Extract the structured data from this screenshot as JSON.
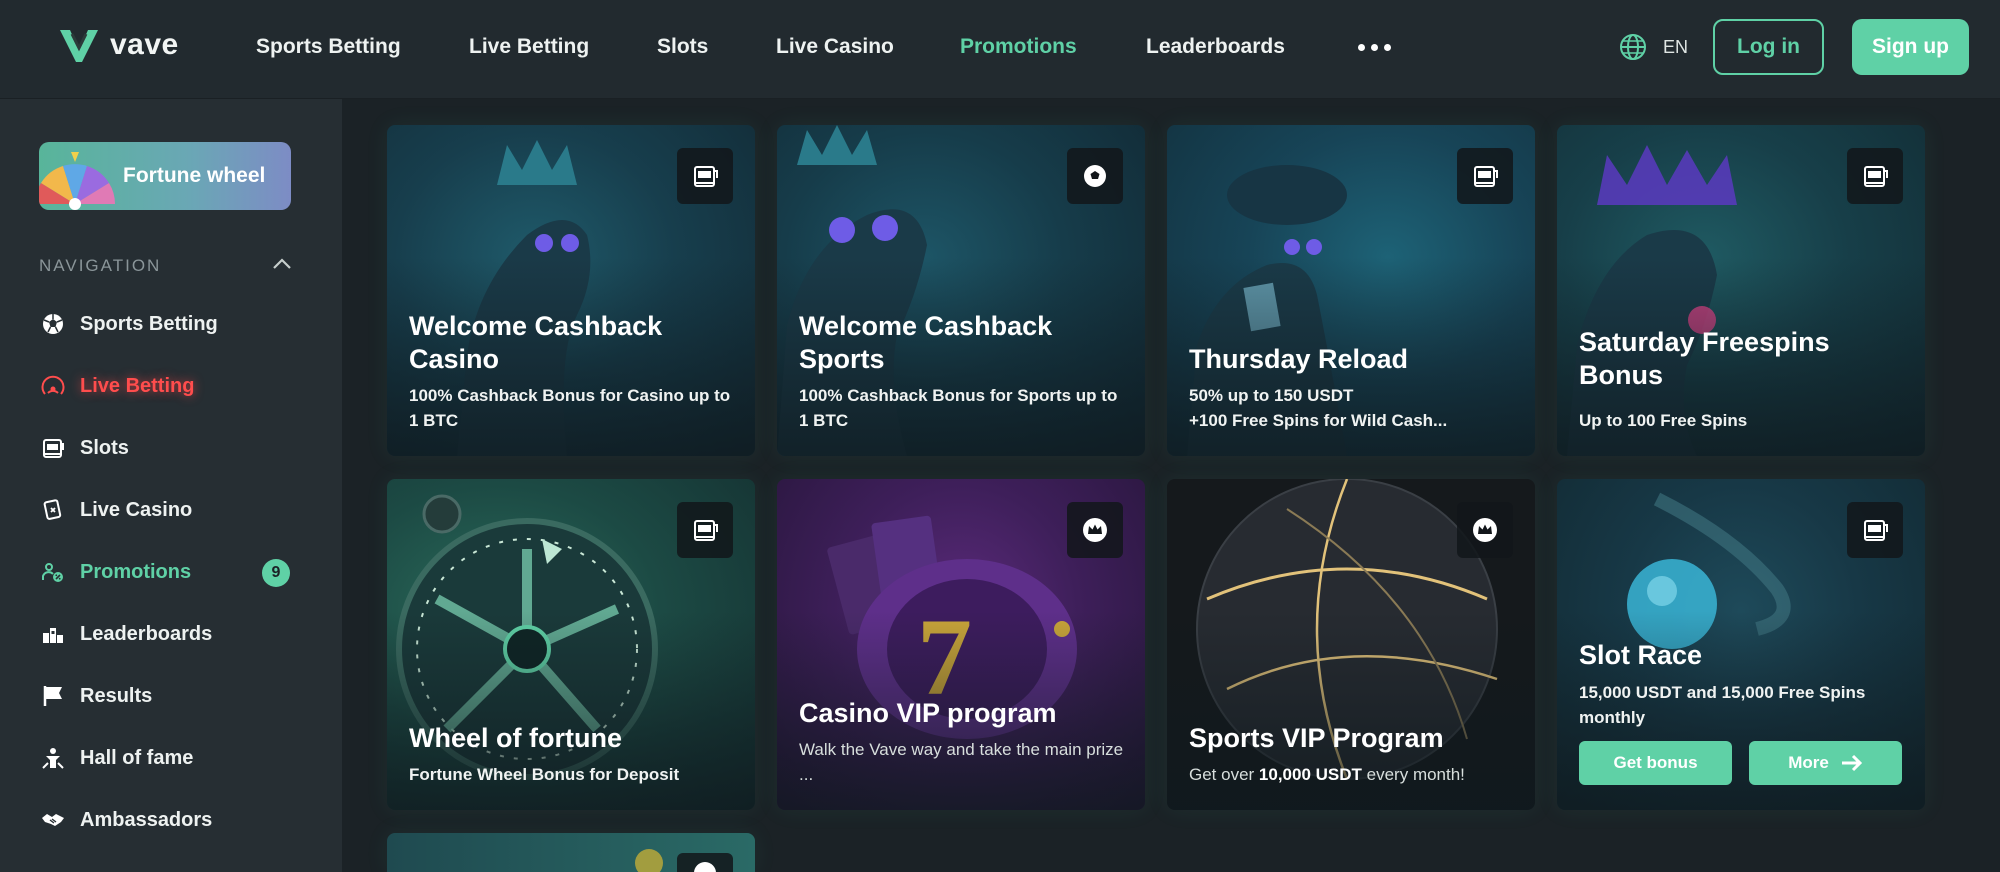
{
  "brand": {
    "name": "vave",
    "accent": "#5fd1a6"
  },
  "topnav": [
    {
      "label": "Sports Betting",
      "active": false
    },
    {
      "label": "Live Betting",
      "active": false
    },
    {
      "label": "Slots",
      "active": false
    },
    {
      "label": "Live Casino",
      "active": false
    },
    {
      "label": "Promotions",
      "active": true
    },
    {
      "label": "Leaderboards",
      "active": false
    }
  ],
  "header": {
    "more_icon": "more-dots-icon",
    "language": "EN",
    "login_label": "Log in",
    "signup_label": "Sign up"
  },
  "sidebar": {
    "fortune_label": "Fortune wheel",
    "nav_title": "NAVIGATION",
    "items": [
      {
        "label": "Sports Betting",
        "icon": "soccer-ball-icon"
      },
      {
        "label": "Live Betting",
        "icon": "live-broadcast-icon"
      },
      {
        "label": "Slots",
        "icon": "slot-machine-icon"
      },
      {
        "label": "Live Casino",
        "icon": "card-chip-icon"
      },
      {
        "label": "Promotions",
        "icon": "promo-gift-icon",
        "badge": "9"
      },
      {
        "label": "Leaderboards",
        "icon": "leaderboard-icon"
      },
      {
        "label": "Results",
        "icon": "flag-icon"
      },
      {
        "label": "Hall of fame",
        "icon": "trophy-person-icon"
      },
      {
        "label": "Ambassadors",
        "icon": "handshake-icon"
      }
    ]
  },
  "promotions": [
    {
      "title": "Welcome Cashback Casino",
      "desc": "100% Cashback Bonus for Casino up to 1 BTC",
      "tag_icon": "slot-machine-icon"
    },
    {
      "title": "Welcome Cashback Sports",
      "desc": "100% Cashback Bonus for Sports up to 1 BTC",
      "tag_icon": "soccer-ball-icon"
    },
    {
      "title": "Thursday Reload",
      "desc_line1": "50% up to 150 USDT",
      "desc_line2": "+100 Free Spins for Wild Cash...",
      "tag_icon": "slot-machine-icon"
    },
    {
      "title": "Saturday Freespins Bonus",
      "desc": "Up to 100 Free Spins",
      "tag_icon": "slot-machine-icon"
    },
    {
      "title": "Wheel of fortune",
      "desc": "Fortune Wheel Bonus for Deposit",
      "tag_icon": "slot-machine-icon"
    },
    {
      "title": "Casino VIP program",
      "desc": "Walk the Vave way and take the main prize ...",
      "tag_icon": "crown-icon"
    },
    {
      "title": "Sports VIP Program",
      "desc_pre": "Get over ",
      "desc_bold": "10,000 USDT",
      "desc_post": " every month!",
      "tag_icon": "crown-icon"
    },
    {
      "title": "Slot Race",
      "desc": "15,000 USDT and 15,000 Free Spins monthly",
      "tag_icon": "slot-machine-icon",
      "btn_bonus": "Get bonus",
      "btn_more": "More"
    }
  ]
}
